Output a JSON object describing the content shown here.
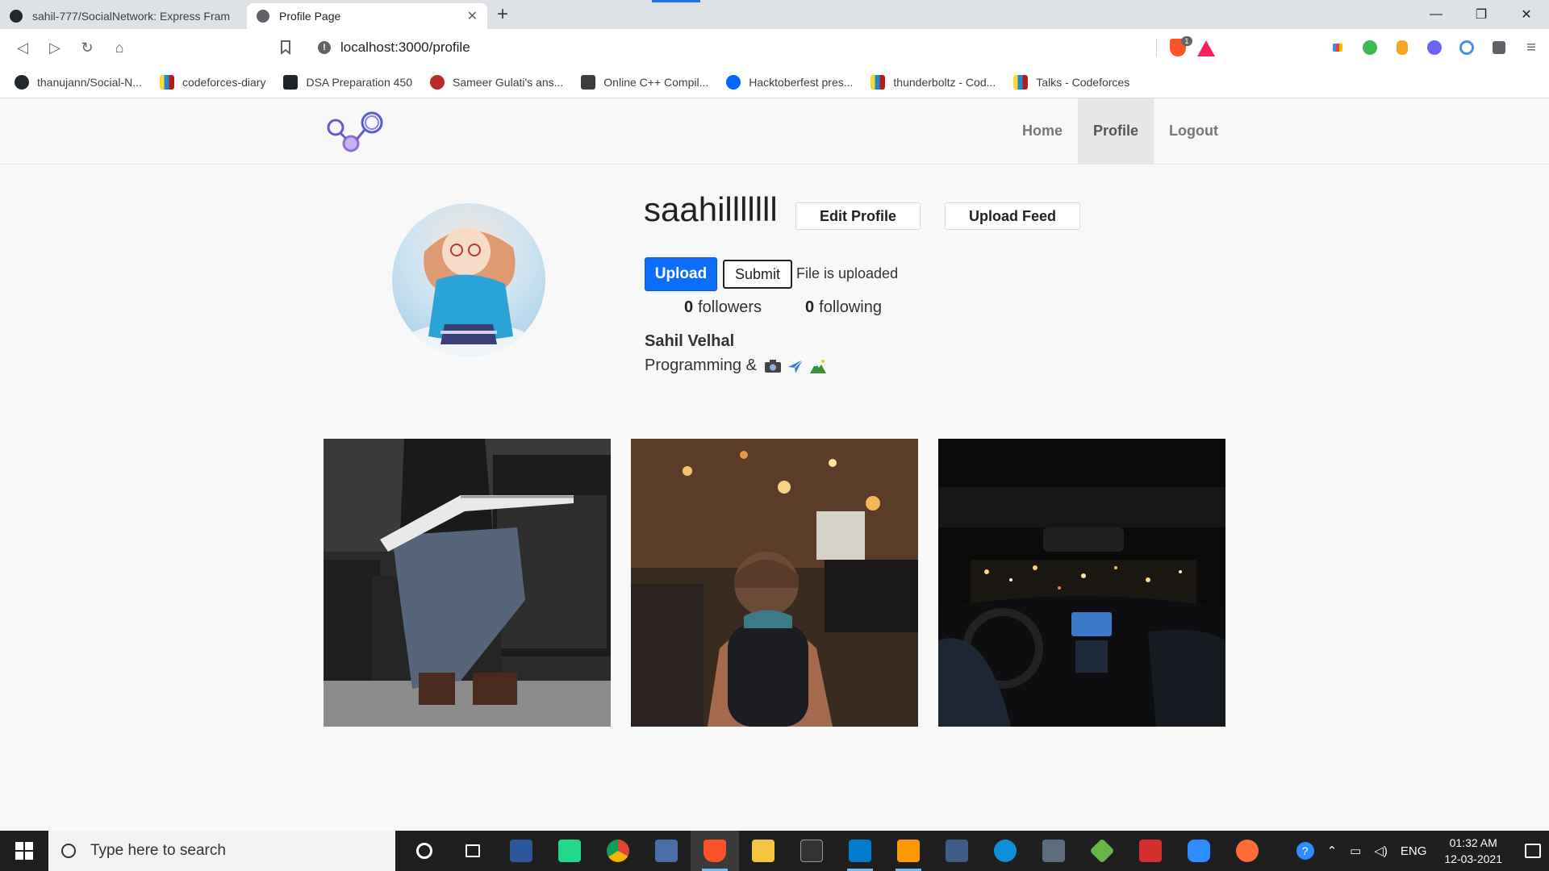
{
  "browser": {
    "tabs": [
      {
        "title": "sahil-777/SocialNetwork: Express Fram",
        "active": false,
        "icon": "github-icon"
      },
      {
        "title": "Profile Page",
        "active": true,
        "icon": "globe-icon"
      }
    ],
    "new_tab": "+",
    "window_controls": {
      "minimize": "—",
      "maximize": "❐",
      "close": "✕"
    },
    "nav": {
      "back": "◁",
      "forward": "▷",
      "reload": "↻",
      "home": "⌂",
      "bookmark": "🔖"
    },
    "url": "localhost:3000/profile",
    "shield_count": "1",
    "bookmarks": [
      {
        "label": "thanujann/Social-N...",
        "icon": "github-icon",
        "color": "#24292e"
      },
      {
        "label": "codeforces-diary",
        "icon": "codeforces-icon",
        "color": "#1f8acb"
      },
      {
        "label": "DSA Preparation 450",
        "icon": "react-icon",
        "color": "#20232a"
      },
      {
        "label": "Sameer Gulati's ans...",
        "icon": "quora-icon",
        "color": "#b92b27"
      },
      {
        "label": "Online C++ Compil...",
        "icon": "coffee-icon",
        "color": "#3c3c3c"
      },
      {
        "label": "Hacktoberfest pres...",
        "icon": "hacktoberfest-icon",
        "color": "#0069ff"
      },
      {
        "label": "thunderboltz - Cod...",
        "icon": "codeforces-icon",
        "color": "#e8a317"
      },
      {
        "label": "Talks - Codeforces",
        "icon": "codeforces-icon",
        "color": "#1f8acb"
      }
    ]
  },
  "site": {
    "nav": {
      "home": "Home",
      "profile": "Profile",
      "logout": "Logout"
    },
    "accent": "#0d6efd"
  },
  "profile": {
    "username": "saahilllllll",
    "edit_label": "Edit Profile",
    "upload_feed_label": "Upload Feed",
    "upload_label": "Upload",
    "submit_label": "Submit",
    "upload_status": "File is uploaded",
    "followers_count": "0",
    "followers_label": "followers",
    "following_count": "0",
    "following_label": "following",
    "full_name": "Sahil Velhal",
    "bio": "Programming &",
    "bio_emojis": [
      "camera-icon",
      "airplane-icon",
      "mountain-icon"
    ]
  },
  "posts": [
    {
      "name": "guitarist-photo"
    },
    {
      "name": "city-street-photo"
    },
    {
      "name": "night-drive-photo"
    }
  ],
  "taskbar": {
    "search_placeholder": "Type here to search",
    "language": "ENG",
    "time": "01:32 AM",
    "date": "12-03-2021"
  }
}
